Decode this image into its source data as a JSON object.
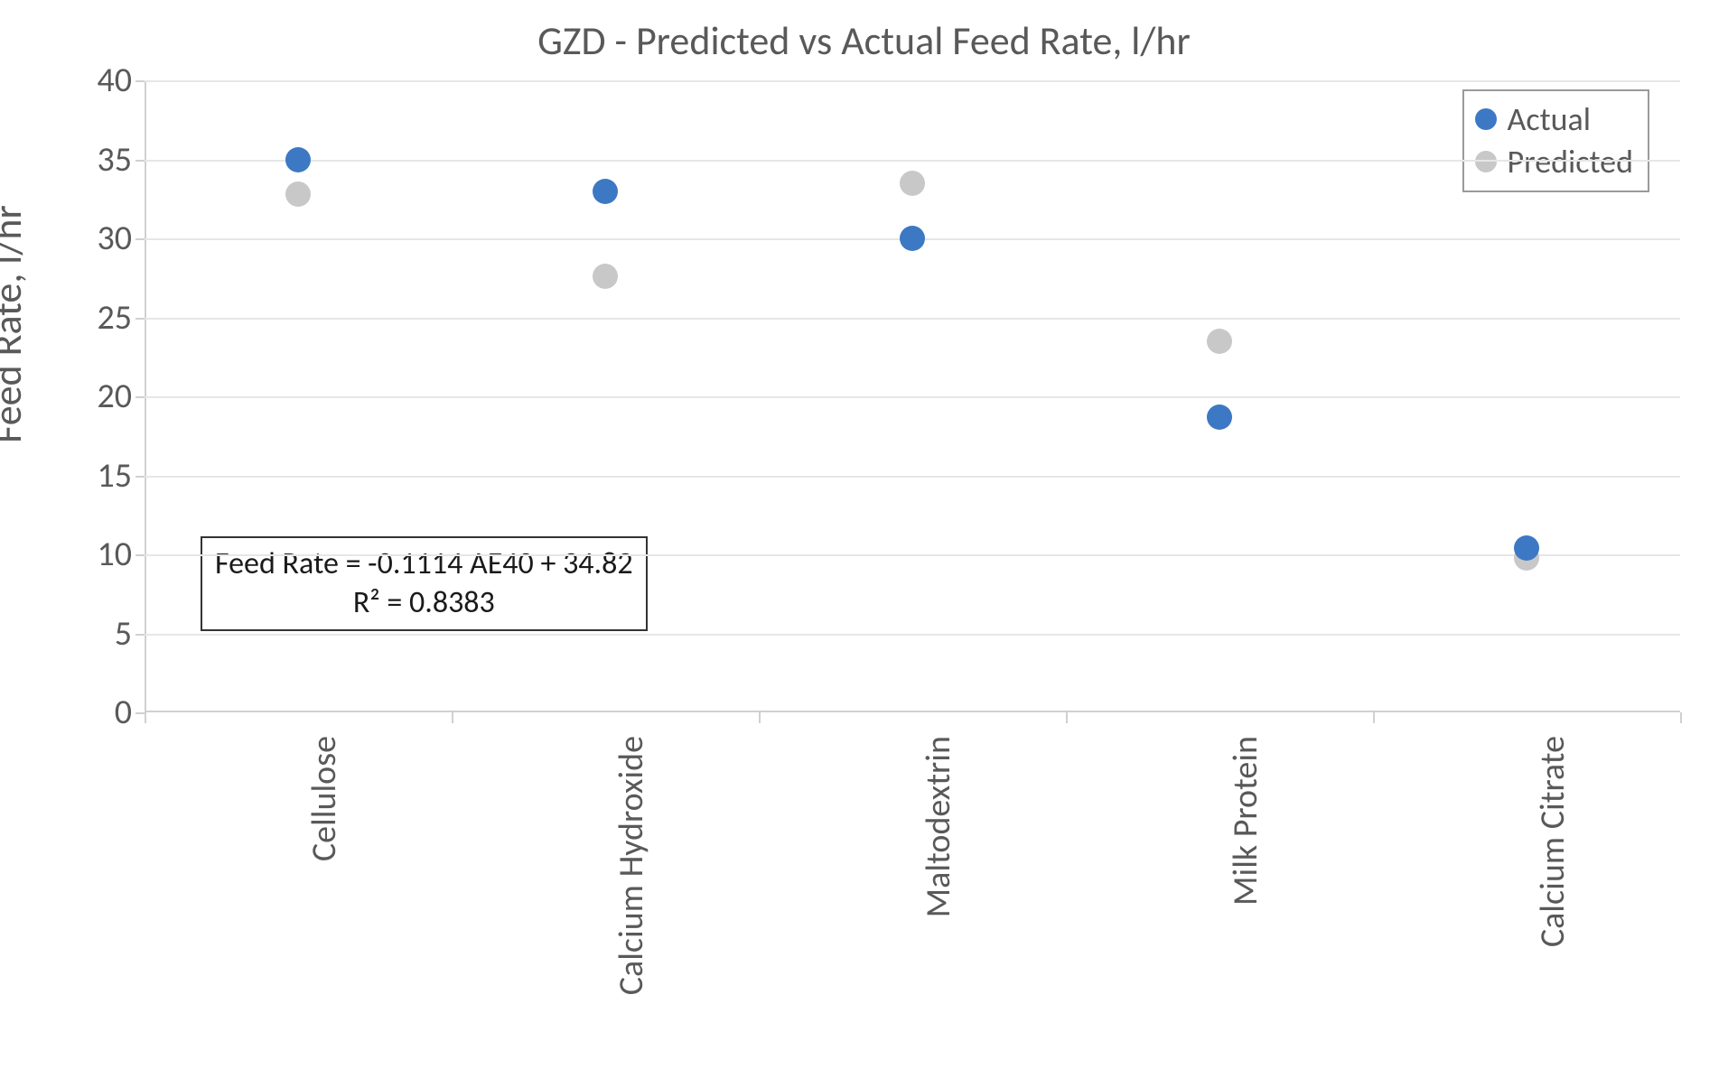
{
  "chart_data": {
    "type": "scatter",
    "title": "GZD - Predicted vs Actual Feed Rate, l/hr",
    "xlabel": "",
    "ylabel": "Feed Rate, l/hr",
    "ylim": [
      0,
      40
    ],
    "y_ticks": [
      0,
      5,
      10,
      15,
      20,
      25,
      30,
      35,
      40
    ],
    "categories": [
      "Cellulose",
      "Calcium Hydroxide",
      "Maltodextrin",
      "Milk Protein",
      "Calcium Citrate"
    ],
    "series": [
      {
        "name": "Actual",
        "values": [
          35.0,
          33.0,
          30.0,
          18.7,
          10.4
        ]
      },
      {
        "name": "Predicted",
        "values": [
          32.8,
          27.6,
          33.5,
          23.5,
          9.8
        ]
      }
    ],
    "legend_position": "top-right",
    "annotation": {
      "equation": "Feed Rate = -0.1114 AE40 + 34.82",
      "r2_label": "R² = 0.8383"
    },
    "colors": {
      "Actual": "#3d78c4",
      "Predicted": "#c8c8c8"
    }
  }
}
